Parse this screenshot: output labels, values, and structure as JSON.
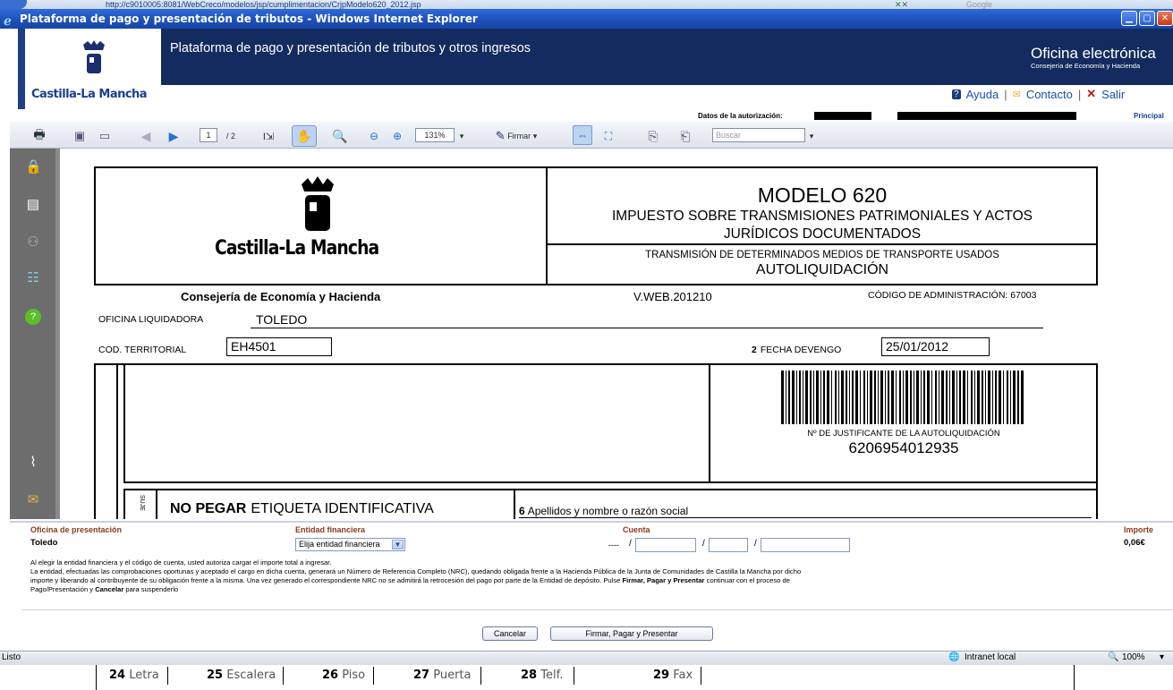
{
  "browser": {
    "address": "http://c9010005:8081/WebCreco/modelos/jsp/cumplimentacion/CrjpModelo620_2012.jsp",
    "search_placeholder": "Google",
    "title": "Plataforma de pago y presentación de tributos - Windows Internet Explorer",
    "status_left": "Listo",
    "zone": "Intranet local",
    "zoom": "100%"
  },
  "site": {
    "logo_text": "Castilla-La Mancha",
    "heading": "Plataforma de pago y presentación de tributos y otros ingresos",
    "office_title": "Oficina electrónica",
    "office_subtitle": "Consejería de Economía y Hacienda",
    "help": "Ayuda",
    "contact": "Contacto",
    "exit": "Salir",
    "auth_label": "Datos de la autorización:",
    "principal": "Principal"
  },
  "pdf_toolbar": {
    "page_current": "1",
    "page_total": "/ 2",
    "zoom": "131%",
    "sign": "Firmar",
    "search_placeholder": "Buscar"
  },
  "form": {
    "region": "Castilla-La Mancha",
    "model": "MODELO 620",
    "tax_title_1": "IMPUESTO SOBRE TRANSMISIONES PATRIMONIALES Y ACTOS",
    "tax_title_2": "JURÍDICOS DOCUMENTADOS",
    "subtitle": "TRANSMISIÓN DE DETERMINADOS MEDIOS DE TRANSPORTE USADOS",
    "autoliq": "AUTOLIQUIDACIÓN",
    "consejeria": "Consejería de Economía y Hacienda",
    "version": "V.WEB.201210",
    "admin_code": "CÓDIGO DE ADMINISTRACIÓN: 67003",
    "office_label": "OFICINA LIQUIDADORA",
    "office_value": "TOLEDO",
    "territorial_label": "COD. TERRITORIAL",
    "territorial_value": "EH4501",
    "devengo_num": "2",
    "devengo_label": "FECHA DEVENGO",
    "devengo_value": "25/01/2012",
    "justificante_label": "Nº DE JUSTIFICANTE DE LA AUTOLIQUIDACIÓN",
    "justificante_value": "6206954012935",
    "vertical_label": "SUJE",
    "no_pegar_bold": "NO PEGAR",
    "no_pegar_rest": "ETIQUETA IDENTIFICATIVA",
    "field6_num": "6",
    "field6_label": "Apellidos y nombre o razón social"
  },
  "payment": {
    "office_header": "Oficina de presentación",
    "office_value": "Toledo",
    "bank_header": "Entidad financiera",
    "bank_selected": "Elija entidad financiera",
    "account_header": "Cuenta",
    "account_prefix": "----",
    "amount_header": "Importe",
    "amount_value": "0,06€",
    "info_1": "Al elegir la entidad financiera y el código de cuenta, usted autoriza cargar el importe total a ingresar.",
    "info_2a": "La entidad, efectuadas las comprobaciones oportunas y aceptado el cargo en dicha cuenta, generará un Número de Referencia Completo (NRC), quedando obligada frente a la Hacienda Pública de la Junta de Comunidades de Castilla la Mancha por dicho",
    "info_2b": "importe y liberando al contribuyente de su obligación frente a la misma. Una vez generado el correspondiente NRC no se admitirá la retrocesión del pago por parte de la Entidad de depósito. Pulse",
    "info_2b_bold": "Firmar, Pagar y Presentar",
    "info_2b_end": "continuar con el proceso de",
    "info_2c": "Pago/Presentación y",
    "info_2c_bold": "Cancelar",
    "info_2c_end": "para suspenderlo",
    "cancel_button": "Cancelar",
    "submit_button": "Firmar, Pagar y Presentar"
  },
  "bottom_row": [
    {
      "num": "24",
      "label": "Letra"
    },
    {
      "num": "25",
      "label": "Escalera"
    },
    {
      "num": "26",
      "label": "Piso"
    },
    {
      "num": "27",
      "label": "Puerta"
    },
    {
      "num": "28",
      "label": "Telf."
    },
    {
      "num": "29",
      "label": "Fax"
    }
  ]
}
